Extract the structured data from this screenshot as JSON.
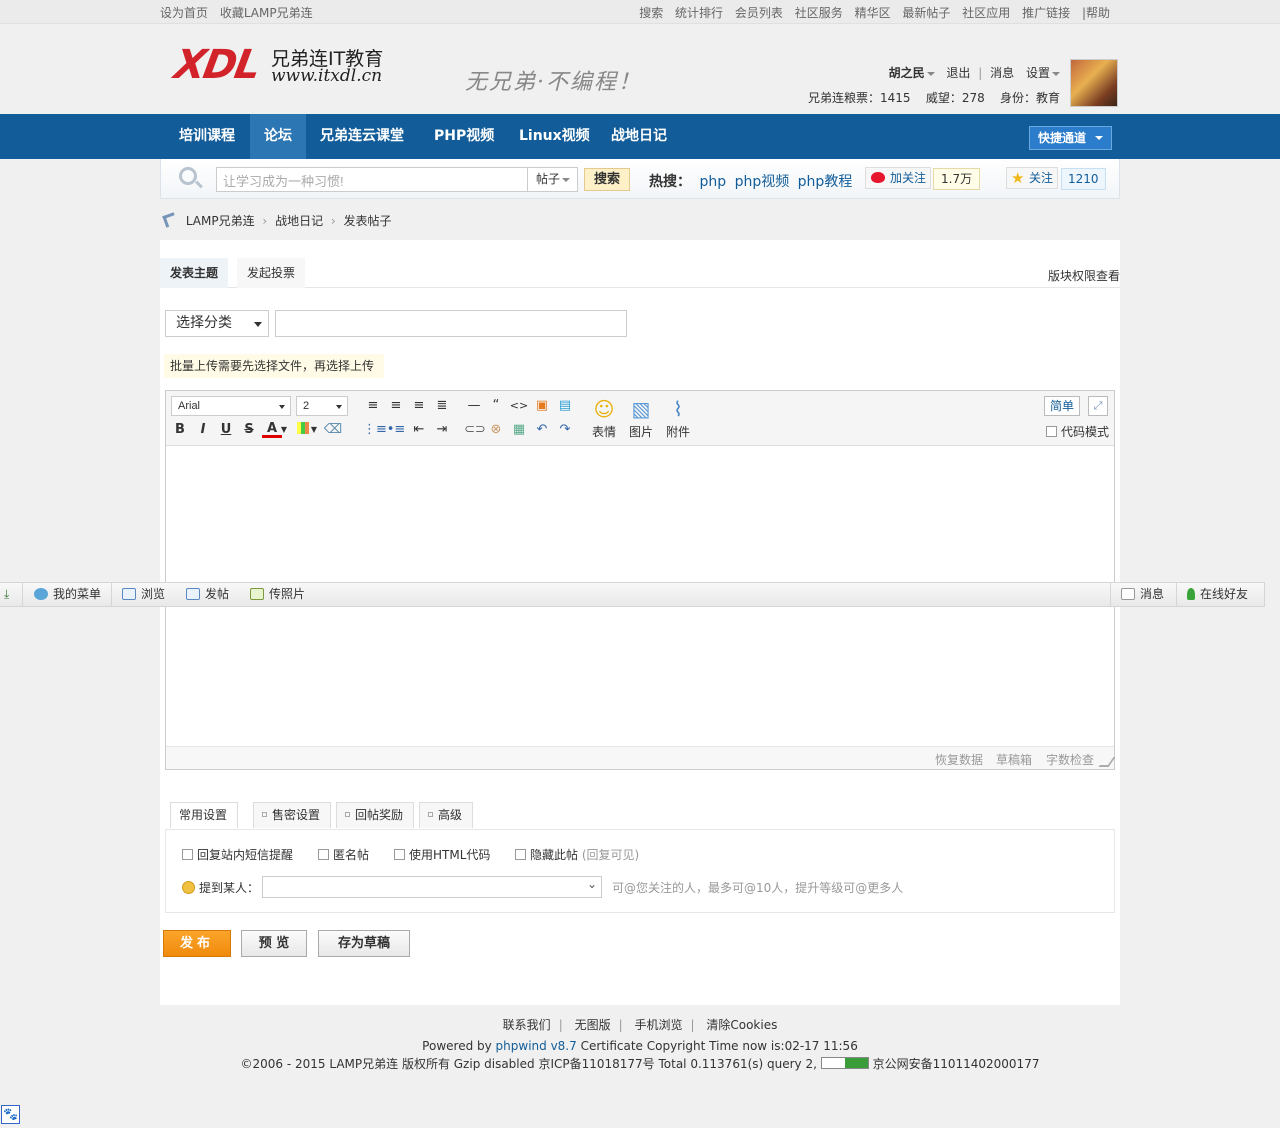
{
  "topbar": {
    "left_links": [
      "设为首页",
      "收藏LAMP兄弟连"
    ],
    "right_links": [
      "搜索",
      "统计排行",
      "会员列表",
      "社区服务",
      "精华区",
      "最新帖子",
      "社区应用",
      "推广链接",
      "|帮助"
    ]
  },
  "logo": {
    "mark": "XDL",
    "name": "兄弟连IT教育",
    "url": "www.itxdl.cn",
    "slogan": "无兄弟·不编程！"
  },
  "user": {
    "name": "胡之民",
    "logout": "退出",
    "messages": "消息",
    "settings": "设置",
    "grain": "兄弟连粮票：1415",
    "prestige": "威望：278",
    "identity": "身份：教育"
  },
  "nav": {
    "items": [
      "培训课程",
      "论坛",
      "兄弟连云课堂",
      "PHP视频",
      "Linux视频",
      "战地日记"
    ],
    "active_index": 1,
    "quick": "快捷通道"
  },
  "search": {
    "placeholder": "让学习成为一种习惯!",
    "type": "帖子",
    "button": "搜索",
    "hot_label": "热搜：",
    "hot_terms": [
      "php",
      "php视频",
      "php教程"
    ],
    "weibo_label": "加关注",
    "weibo_count": "1.7万",
    "follow_label": "关注",
    "follow_count": "1210"
  },
  "breadcrumb": [
    "LAMP兄弟连",
    "战地日记",
    "发表帖子"
  ],
  "post": {
    "tabs": [
      "发表主题",
      "发起投票"
    ],
    "permissions": "版块权限查看",
    "category_placeholder": "选择分类",
    "upload_tip": "批量上传需要先选择文件，再选择上传"
  },
  "editor": {
    "font": "Arial",
    "size": "2",
    "emoji_label": "表情",
    "image_label": "图片",
    "attach_label": "附件",
    "simple_label": "简单",
    "code_mode": "代码模式",
    "footer_links": [
      "恢复数据",
      "草稿箱",
      "字数检查"
    ]
  },
  "settings": {
    "tabs": [
      "常用设置",
      "售密设置",
      "回帖奖励",
      "高级"
    ],
    "options": [
      "回复站内短信提醒",
      "匿名帖",
      "使用HTML代码",
      "隐藏此帖"
    ],
    "hide_hint": "(回复可见)",
    "mention_label": "提到某人：",
    "mention_tip": "可@您关注的人，最多可@10人，提升等级可@更多人"
  },
  "buttons": {
    "publish": "发布",
    "preview": "预 览",
    "draft": "存为草稿"
  },
  "floatbar": {
    "items": [
      "我的菜单",
      "浏览",
      "发帖",
      "传照片"
    ],
    "right_items": [
      "消息",
      "在线好友"
    ]
  },
  "footer": {
    "links": [
      "联系我们",
      "无图版",
      "手机浏览",
      "清除Cookies"
    ],
    "powered_prefix": "Powered by ",
    "powered_link": "phpwind v8.7",
    "powered_suffix": " Certificate Copyright Time now is:02-17 11:56",
    "copyright": "©2006 - 2015 LAMP兄弟连 版权所有 Gzip disabled 京ICP备11018177号 Total 0.113761(s) query 2,",
    "police": "京公网安备11011402000177"
  },
  "colors": {
    "nav_bg": "#125d99",
    "nav_active": "#2b76b3",
    "publish_btn": "#f39512",
    "logo_red": "#d2232a"
  }
}
